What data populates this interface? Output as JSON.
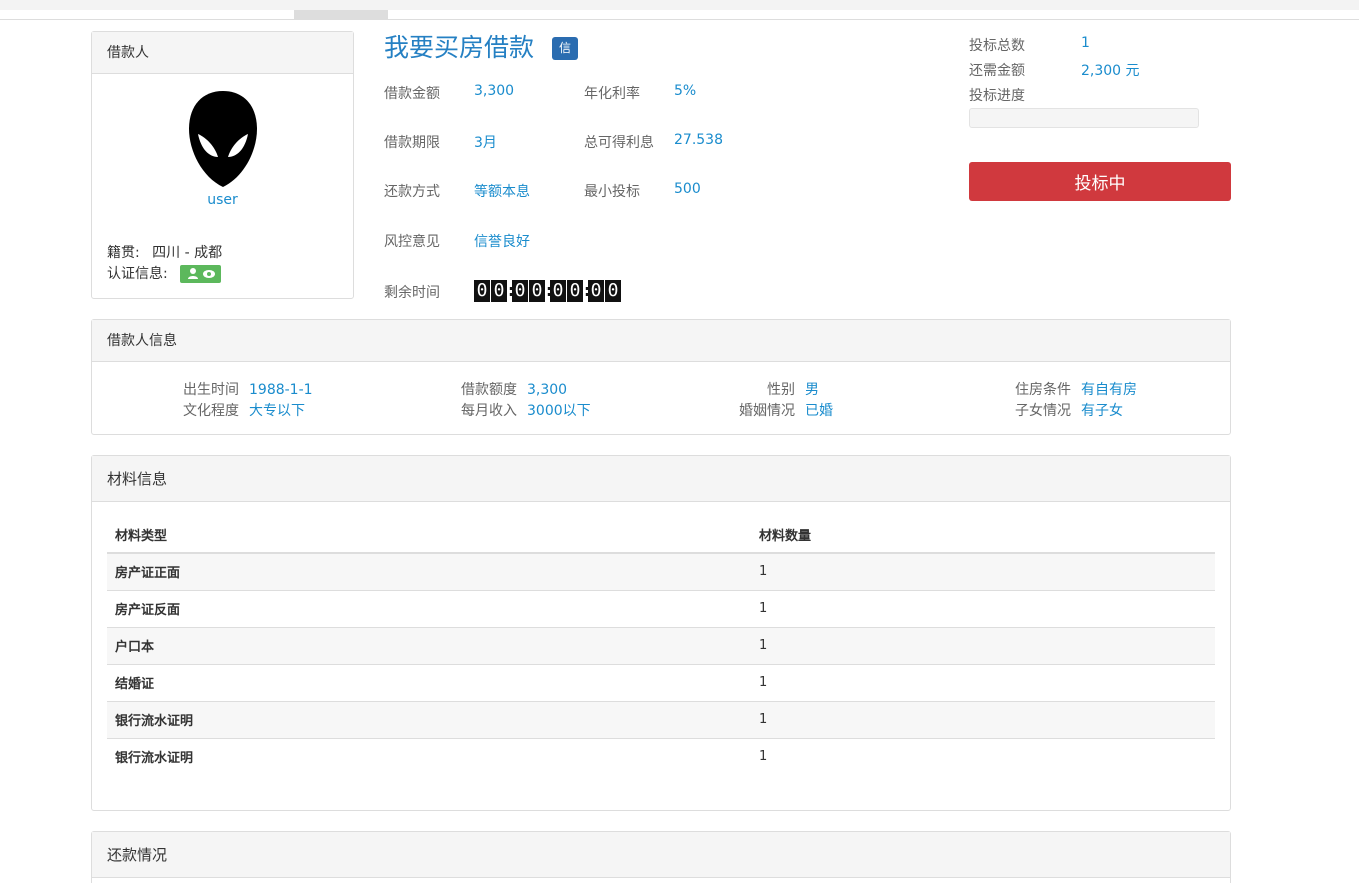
{
  "borrower": {
    "heading": "借款人",
    "username": "user",
    "origin_label": "籍贯:",
    "origin_value": "四川 - 成都",
    "cert_label": "认证信息:"
  },
  "loan": {
    "title": "我要买房借款",
    "credit_badge": "信",
    "fields": {
      "amount_label": "借款金额",
      "amount_value": "3,300",
      "rate_label": "年化利率",
      "rate_value": "5%",
      "term_label": "借款期限",
      "term_value": "3月",
      "interest_label": "总可得利息",
      "interest_value": "27.538",
      "repay_label": "还款方式",
      "repay_value": "等额本息",
      "minbid_label": "最小投标",
      "minbid_value": "500",
      "risk_label": "风控意见",
      "risk_value": "信誉良好",
      "remain_label": "剩余时间"
    },
    "timer": [
      "0",
      "0",
      "0",
      "0",
      "0",
      "0",
      "0",
      "0"
    ]
  },
  "stats": {
    "bids_label": "投标总数",
    "bids_value": "1",
    "need_label": "还需金额",
    "need_value": "2,300 元",
    "progress_label": "投标进度",
    "progress_percent": 0,
    "button_label": "投标中"
  },
  "info": {
    "heading": "借款人信息",
    "birth_label": "出生时间",
    "birth_value": "1988-1-1",
    "quota_label": "借款额度",
    "quota_value": "3,300",
    "gender_label": "性别",
    "gender_value": "男",
    "housing_label": "住房条件",
    "housing_value": "有自有房",
    "edu_label": "文化程度",
    "edu_value": "大专以下",
    "income_label": "每月收入",
    "income_value": "3000以下",
    "marriage_label": "婚姻情况",
    "marriage_value": "已婚",
    "children_label": "子女情况",
    "children_value": "有子女"
  },
  "materials": {
    "heading": "材料信息",
    "col_type": "材料类型",
    "col_count": "材料数量",
    "rows": [
      {
        "name": "房产证正面",
        "count": "1"
      },
      {
        "name": "房产证反面",
        "count": "1"
      },
      {
        "name": "户口本",
        "count": "1"
      },
      {
        "name": "结婚证",
        "count": "1"
      },
      {
        "name": "银行流水证明",
        "count": "1"
      },
      {
        "name": "银行流水证明",
        "count": "1"
      }
    ]
  },
  "repayment": {
    "heading": "还款情况"
  },
  "colors": {
    "accent": "#1a8ccd",
    "bid_button": "#d0393e",
    "cert_badge": "#5cb85c",
    "credit_badge": "#2a6cb0"
  },
  "icons": [
    "spiderman-avatar-icon",
    "user-icon",
    "eye-icon"
  ]
}
